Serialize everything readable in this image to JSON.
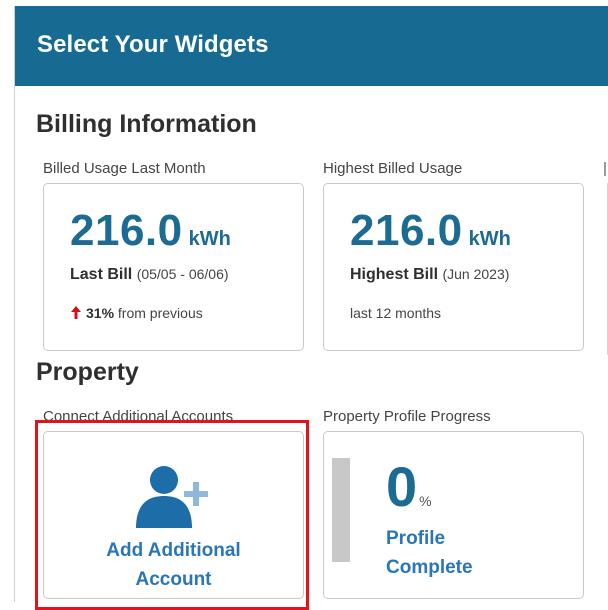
{
  "header": {
    "title": "Select Your Widgets"
  },
  "billing": {
    "section_title": "Billing Information",
    "widgets": [
      {
        "label": "Billed Usage Last Month",
        "value": "216.0",
        "unit": "kWh",
        "bill_label": "Last Bill",
        "bill_period": "(05/05 - 06/06)",
        "change_icon": "arrow-up-icon",
        "change_pct": "31%",
        "change_text": "from previous"
      },
      {
        "label": "Highest Billed Usage",
        "value": "216.0",
        "unit": "kWh",
        "bill_label": "Highest Bill",
        "bill_period": "(Jun 2023)",
        "footer": "last 12 months"
      }
    ]
  },
  "property": {
    "section_title": "Property",
    "add_account": {
      "label": "Connect Additional Accounts",
      "icon": "add-user-icon",
      "line1": "Add Additional",
      "line2": "Account"
    },
    "profile_progress": {
      "label": "Property Profile Progress",
      "value": "0",
      "unit": "%",
      "progress_fraction": 0,
      "line1": "Profile",
      "line2": "Complete"
    }
  },
  "colors": {
    "header_bg": "#176b93",
    "value_blue": "#1c6b92",
    "link_blue": "#2a76b6",
    "up_arrow": "#d0101a",
    "highlight": "#e1141c"
  }
}
